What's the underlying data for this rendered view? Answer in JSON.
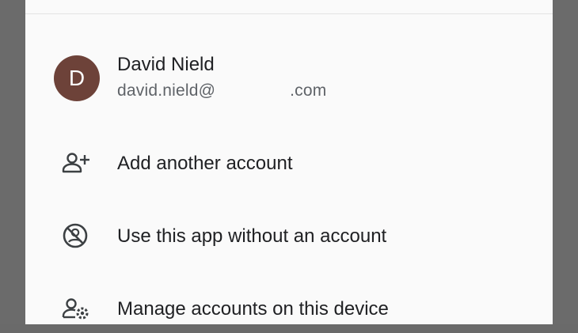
{
  "account": {
    "avatar_initial": "D",
    "name": "David Nield",
    "email_user": "david.nield@",
    "email_domain_suffix": ".com",
    "avatar_color": "#6d4239"
  },
  "menu": {
    "items": [
      {
        "label": "Add another account",
        "icon": "person-add-icon"
      },
      {
        "label": "Use this app without an account",
        "icon": "no-account-icon"
      },
      {
        "label": "Manage accounts on this device",
        "icon": "manage-accounts-icon"
      }
    ]
  }
}
